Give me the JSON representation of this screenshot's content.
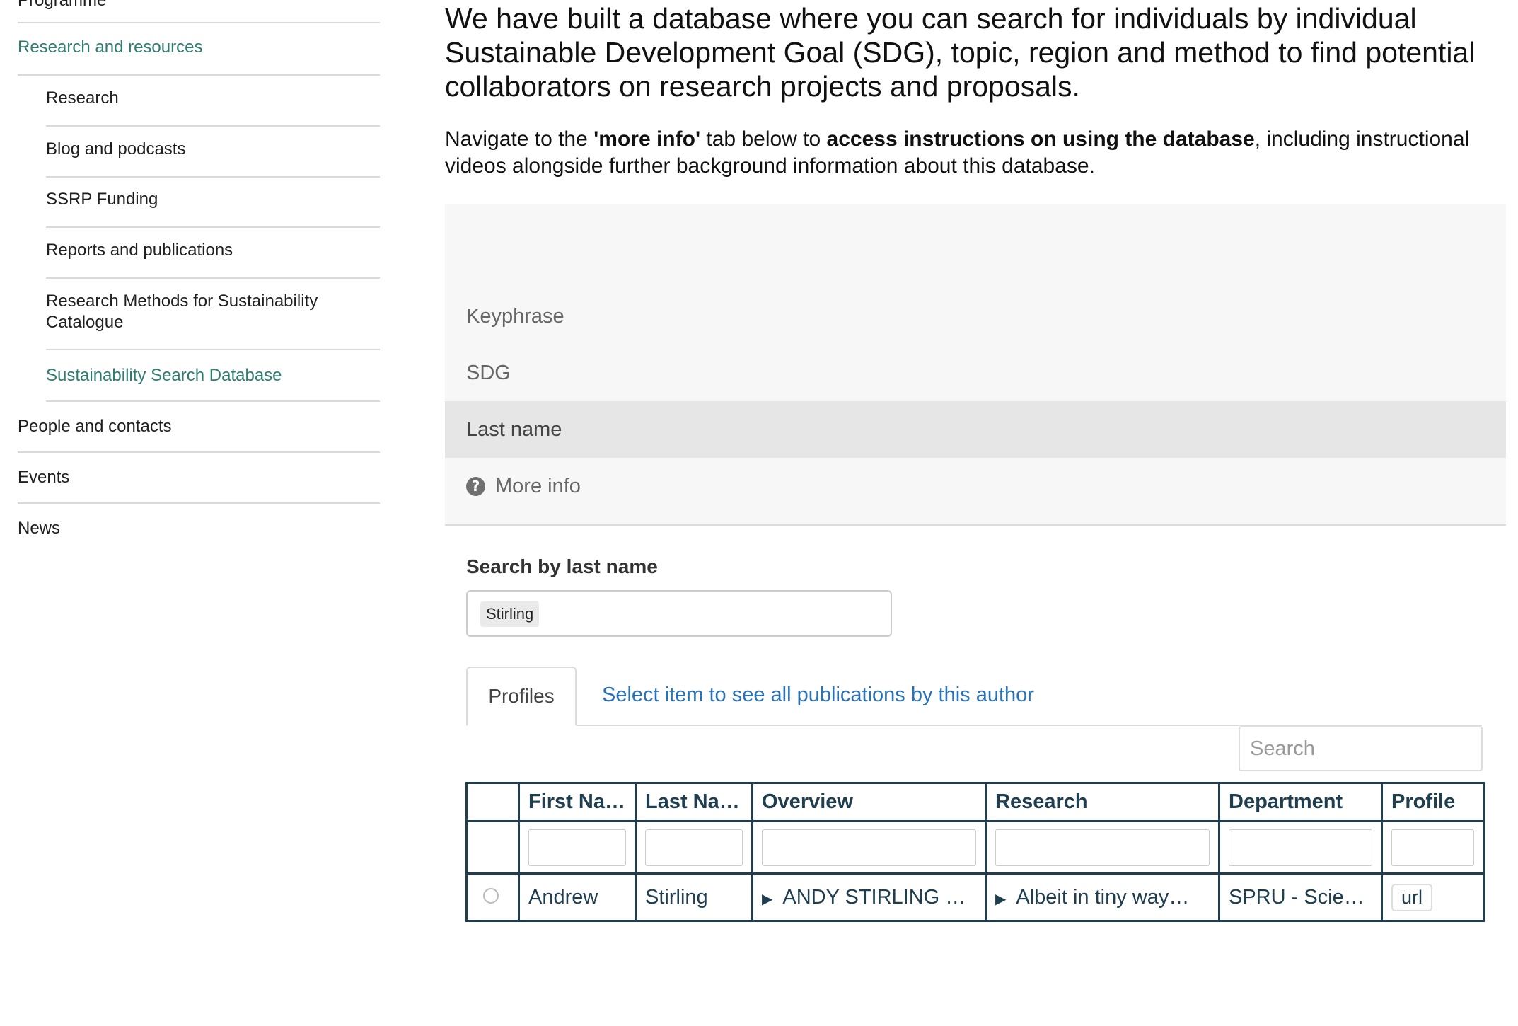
{
  "sidebar": {
    "items": [
      {
        "label": "Programme",
        "active": false
      },
      {
        "label": "Research and resources",
        "active": true
      },
      {
        "label": "Research",
        "sub": true
      },
      {
        "label": "Blog and podcasts",
        "sub": true
      },
      {
        "label": "SSRP Funding",
        "sub": true
      },
      {
        "label": "Reports and publications",
        "sub": true
      },
      {
        "label": "Research Methods for Sustainability Catalogue",
        "sub": true
      },
      {
        "label": "Sustainability Search Database",
        "sub": true,
        "active": true
      },
      {
        "label": "People and contacts"
      },
      {
        "label": "Events"
      },
      {
        "label": "News"
      }
    ]
  },
  "intro": {
    "text": "We have built a database where you can search for individuals by individual Sustainable Development Goal (SDG), topic, region and method to find potential collaborators on research projects and proposals.",
    "note_prefix": "Navigate to the ",
    "note_more_info": "'more info'",
    "note_middle": " tab below to ",
    "note_access": "access instructions on using the database",
    "note_suffix": ", including instructional videos alongside further background information about this database."
  },
  "panel": {
    "items": [
      "Keyphrase",
      "SDG",
      "Last name",
      "More info"
    ],
    "selected": "Last name"
  },
  "search": {
    "label": "Search by last name",
    "value": "Stirling"
  },
  "tabs": {
    "profiles": "Profiles",
    "link": "Select item to see all publications by this author"
  },
  "table": {
    "search_placeholder": "Search",
    "columns": [
      "",
      "First Na…",
      "Last Na…",
      "Overview",
      "Research",
      "Department",
      "Profile"
    ],
    "rows": [
      {
        "first_name": "Andrew",
        "last_name": "Stirling",
        "overview": "ANDY STIRLING …",
        "research": "Albeit in tiny way…",
        "department": "SPRU - Scien…",
        "profile": "url"
      }
    ]
  },
  "colors": {
    "accent_green": "#2e7d6f",
    "link_blue": "#2a72b8",
    "table_border": "#1f3e50"
  }
}
